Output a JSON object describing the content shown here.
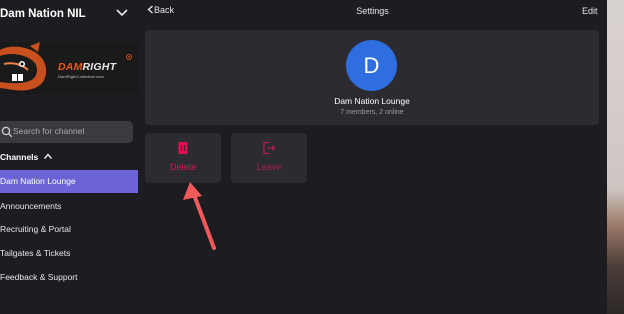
{
  "sidebar": {
    "org_name": "Dam Nation NIL",
    "banner": {
      "brand_primary": "DAM",
      "brand_secondary": "RIGHT",
      "tagline": "DamRightCollective.com"
    },
    "search": {
      "placeholder": "Search for channel"
    },
    "channels_heading": "Channels",
    "channels": [
      {
        "label": "Dam Nation Lounge",
        "active": true
      },
      {
        "label": "Announcements",
        "active": false
      },
      {
        "label": "Recruiting & Portal",
        "active": false
      },
      {
        "label": "Tailgates & Tickets",
        "active": false
      },
      {
        "label": "Feedback & Support",
        "active": false
      }
    ]
  },
  "topbar": {
    "back_label": "Back",
    "title": "Settings",
    "edit_label": "Edit"
  },
  "channel": {
    "avatar_letter": "D",
    "name": "Dam Nation Lounge",
    "meta": "7 members, 2 online"
  },
  "actions": {
    "delete_label": "Delete",
    "leave_label": "Leave"
  },
  "colors": {
    "accent_active": "#6c63d6",
    "avatar_bg": "#2f6ee0",
    "danger": "#e0104f",
    "annotation_arrow": "#f05a5a"
  },
  "icons": {
    "org_chevron": "chevron-down-icon",
    "search": "search-icon",
    "channels_toggle": "chevron-up-icon",
    "back": "chevron-left-icon",
    "delete": "trash-icon",
    "leave": "exit-icon",
    "annotation": "arrow-icon"
  }
}
